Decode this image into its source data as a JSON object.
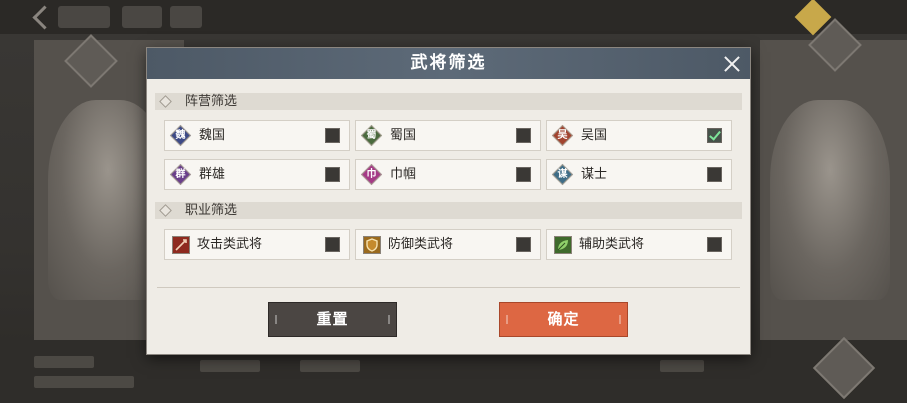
{
  "dialog": {
    "title": "武将筛选",
    "close_icon": "close-icon",
    "sections": {
      "faction": {
        "title": "阵营筛选",
        "options": [
          {
            "label": "魏国",
            "badge": "魏",
            "color": "#3d4a86",
            "checked": false
          },
          {
            "label": "蜀国",
            "badge": "蜀",
            "color": "#4a6a3e",
            "checked": false
          },
          {
            "label": "吴国",
            "badge": "吴",
            "color": "#a2442f",
            "checked": true
          },
          {
            "label": "群雄",
            "badge": "群",
            "color": "#6a3f8a",
            "checked": false
          },
          {
            "label": "巾帼",
            "badge": "巾",
            "color": "#a53a86",
            "checked": false
          },
          {
            "label": "谋士",
            "badge": "谋",
            "color": "#3f6d87",
            "checked": false
          }
        ]
      },
      "profession": {
        "title": "职业筛选",
        "options": [
          {
            "label": "攻击类武将",
            "icon": "sword-icon",
            "color": "#8e2a1f",
            "checked": false
          },
          {
            "label": "防御类武将",
            "icon": "shield-icon",
            "color": "#9a6a1e",
            "checked": false
          },
          {
            "label": "辅助类武将",
            "icon": "leaf-icon",
            "color": "#3f6a2c",
            "checked": false
          }
        ]
      }
    },
    "buttons": {
      "reset": "重置",
      "confirm": "确定"
    },
    "colors": {
      "header": "#55616e",
      "confirm": "#dd6743",
      "reset": "#4b4643",
      "check": "#7ee59a"
    }
  }
}
